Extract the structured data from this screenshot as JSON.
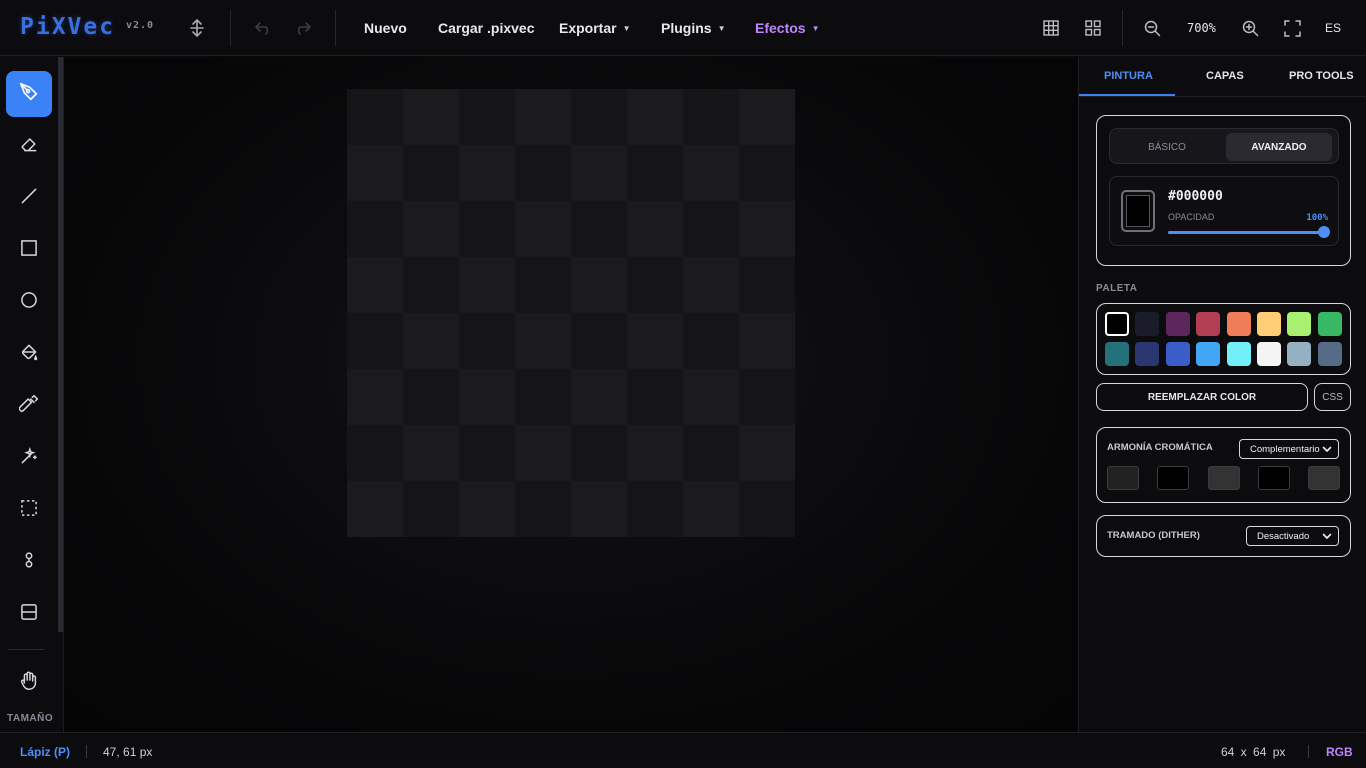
{
  "app": {
    "logo": "PiXVec",
    "version": "v2.0"
  },
  "menu": {
    "nuevo": "Nuevo",
    "cargar": "Cargar .pixvec",
    "exportar": "Exportar",
    "plugins": "Plugins",
    "efectos": "Efectos",
    "caret": "▼"
  },
  "view": {
    "zoom": "700%",
    "lang": "ES"
  },
  "toolbar": {
    "tools": [
      "pen-icon",
      "eraser-icon",
      "line-icon",
      "rectangle-icon",
      "circle-icon",
      "fill-bucket-icon",
      "eyedropper-icon",
      "magic-wand-icon",
      "selection-icon",
      "bone-icon",
      "layers-split-icon",
      "hand-icon"
    ],
    "active_tool": "pen-icon",
    "size_label": "TAMAÑO"
  },
  "panel": {
    "tabs": [
      "PINTURA",
      "CAPAS",
      "PRO TOOLS"
    ],
    "active_tab": "PINTURA",
    "mode_tabs": {
      "basic": "BÁSICO",
      "advanced": "AVANZADO",
      "active": "AVANZADO"
    },
    "color": {
      "hex": "#000000",
      "opacity_label": "OPACIDAD",
      "opacity_value": "100%",
      "opacity_fraction": 1.0
    },
    "palette_label": "PALETA",
    "palette": [
      "#000000",
      "#1a1c2c",
      "#5d275d",
      "#b13e53",
      "#ef7d57",
      "#ffcd75",
      "#a7f070",
      "#38b764",
      "#257179",
      "#29366f",
      "#3b5dc9",
      "#41a6f6",
      "#73eff7",
      "#f4f4f4",
      "#94b0c2",
      "#566c86"
    ],
    "selected_swatch": 0,
    "replace_button": "REEMPLAZAR COLOR",
    "css_button": "CSS",
    "harmony": {
      "label": "ARMONÍA CROMÁTICA",
      "value": "Complementario",
      "swatches": [
        "#222222",
        "#000000",
        "#333333",
        "#000000",
        "#333333"
      ]
    },
    "dither": {
      "label": "TRAMADO (DITHER)",
      "value": "Desactivado"
    }
  },
  "status": {
    "tool": "Lápiz (P)",
    "coords": "47, 61 px",
    "size": "64 x 64 px",
    "mode": "RGB"
  },
  "colors": {
    "accent": "#3b82f6",
    "effects": "#c084fc",
    "logo": "#3a6fe0"
  }
}
